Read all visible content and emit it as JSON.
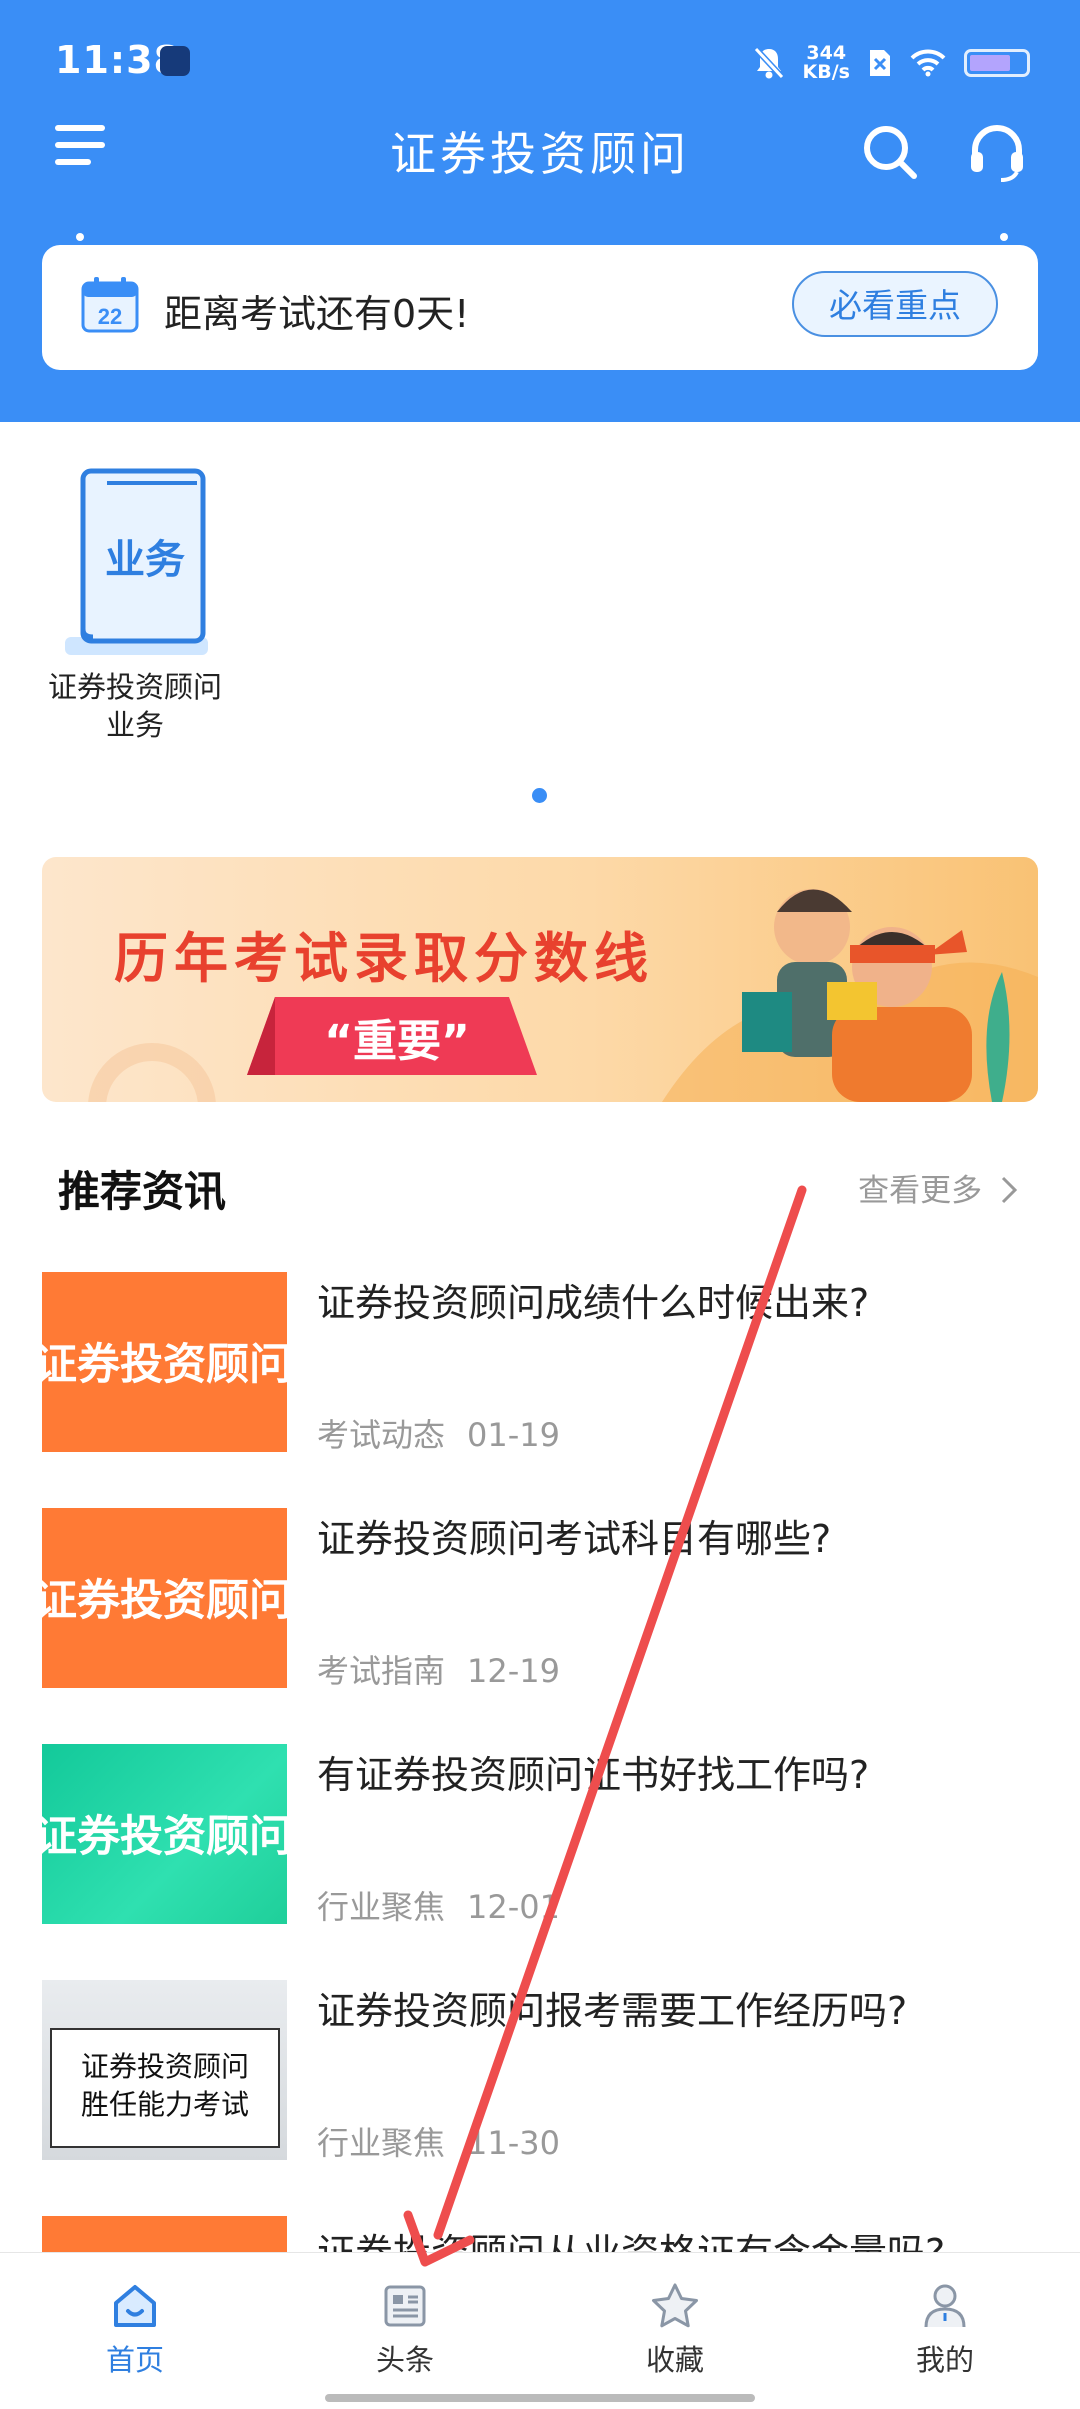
{
  "status_bar": {
    "time": "11:38",
    "net_speed_value": "344",
    "net_speed_unit": "KB/s"
  },
  "header": {
    "title": "证券投资顾问",
    "icons": [
      "menu-icon",
      "search-icon",
      "headset-icon"
    ]
  },
  "countdown": {
    "calendar_day": "22",
    "text": "距离考试还有0天!",
    "button_label": "必看重点"
  },
  "subjects": [
    {
      "icon_text": "业务",
      "label_line1": "证券投资顾问",
      "label_line2": "业务"
    }
  ],
  "banner": {
    "title": "历年考试录取分数线",
    "badge": "“重要”"
  },
  "recommended": {
    "heading": "推荐资讯",
    "more_label": "查看更多",
    "items": [
      {
        "title": "证券投资顾问成绩什么时候出来?",
        "category": "考试动态",
        "date": "01-19",
        "thumb_text": "证券投资顾问",
        "thumb_color": "#ff7a35"
      },
      {
        "title": "证券投资顾问考试科目有哪些?",
        "category": "考试指南",
        "date": "12-19",
        "thumb_text": "证券投资顾问",
        "thumb_color": "#ff7a35"
      },
      {
        "title": "有证券投资顾问证书好找工作吗?",
        "category": "行业聚焦",
        "date": "12-01",
        "thumb_text": "证券投资顾问",
        "thumb_color": "#1fcf9a"
      },
      {
        "title": "证券投资顾问报考需要工作经历吗?",
        "category": "行业聚焦",
        "date": "11-30",
        "thumb_line1": "证券投资顾问",
        "thumb_line2": "胜任能力考试"
      },
      {
        "title": "证券投资顾问从业资格证有含金量吗?",
        "thumb_color": "#ff7a35"
      }
    ]
  },
  "tabbar": {
    "tabs": [
      {
        "label": "首页",
        "icon": "home-icon",
        "active": true
      },
      {
        "label": "头条",
        "icon": "news-icon",
        "active": false
      },
      {
        "label": "收藏",
        "icon": "star-icon",
        "active": false
      },
      {
        "label": "我的",
        "icon": "user-icon",
        "active": false
      }
    ]
  },
  "colors": {
    "primary": "#3a8ef6",
    "accent_text": "#2f7fe0",
    "banner_red": "#e8412e",
    "annotation_arrow": "#ee4d4d"
  }
}
